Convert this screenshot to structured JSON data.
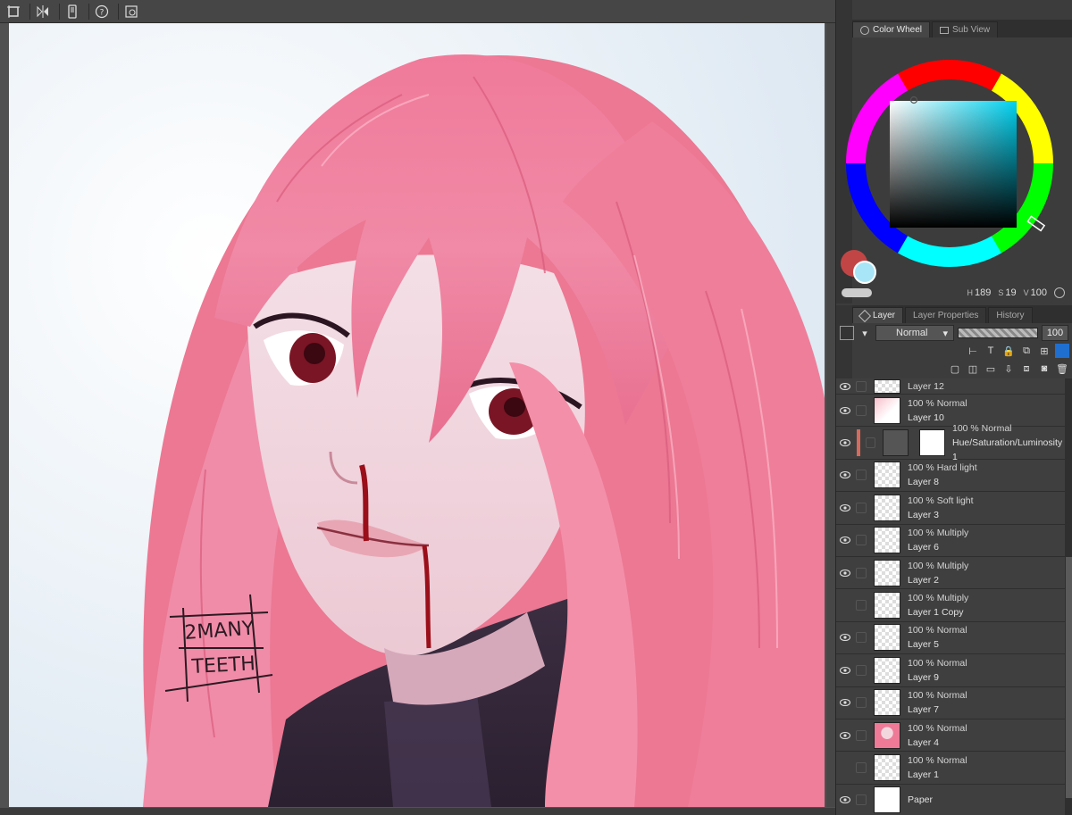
{
  "toolbar": {
    "icons": [
      "transform-icon",
      "crop-icon",
      "flip-icon",
      "phone-icon",
      "help-icon",
      "settings-icon"
    ]
  },
  "color_panel": {
    "tabs": [
      {
        "label": "Color Wheel",
        "active": true
      },
      {
        "label": "Sub View",
        "active": false
      }
    ],
    "main_color": "#c24545",
    "sub_color": "#a8e6f7",
    "h": "189",
    "s": "19",
    "v": "100"
  },
  "layer_panel": {
    "tabs": [
      {
        "label": "Layer",
        "active": true
      },
      {
        "label": "Layer Properties",
        "active": false
      },
      {
        "label": "History",
        "active": false
      }
    ],
    "blend_mode": "Normal",
    "opacity": "100",
    "layers": [
      {
        "line1": "Layer 12",
        "line2": "",
        "type": "partial"
      },
      {
        "line1": "100 % Normal",
        "line2": "Layer 10",
        "type": "img-pink"
      },
      {
        "line1": "100 % Normal",
        "line2": "Hue/Saturation/Luminosity 1",
        "type": "adjust"
      },
      {
        "line1": "100 % Hard light",
        "line2": "Layer 8",
        "type": "checker"
      },
      {
        "line1": "100 % Soft light",
        "line2": "Layer 3",
        "type": "checker"
      },
      {
        "line1": "100 % Multiply",
        "line2": "Layer 6",
        "type": "checker"
      },
      {
        "line1": "100 % Multiply",
        "line2": "Layer 2",
        "type": "checker"
      },
      {
        "line1": "100 % Multiply",
        "line2": "Layer 1 Copy",
        "type": "checker-hidden"
      },
      {
        "line1": "100 % Normal",
        "line2": "Layer 5",
        "type": "checker"
      },
      {
        "line1": "100 % Normal",
        "line2": "Layer 9",
        "type": "checker"
      },
      {
        "line1": "100 % Normal",
        "line2": "Layer 7",
        "type": "checker"
      },
      {
        "line1": "100 % Normal",
        "line2": "Layer 4",
        "type": "img-face"
      },
      {
        "line1": "100 % Normal",
        "line2": "Layer 1",
        "type": "checker-hidden"
      },
      {
        "line1": "",
        "line2": "Paper",
        "type": "paper"
      }
    ]
  },
  "artwork": {
    "signature": "2MANY TEETH"
  }
}
